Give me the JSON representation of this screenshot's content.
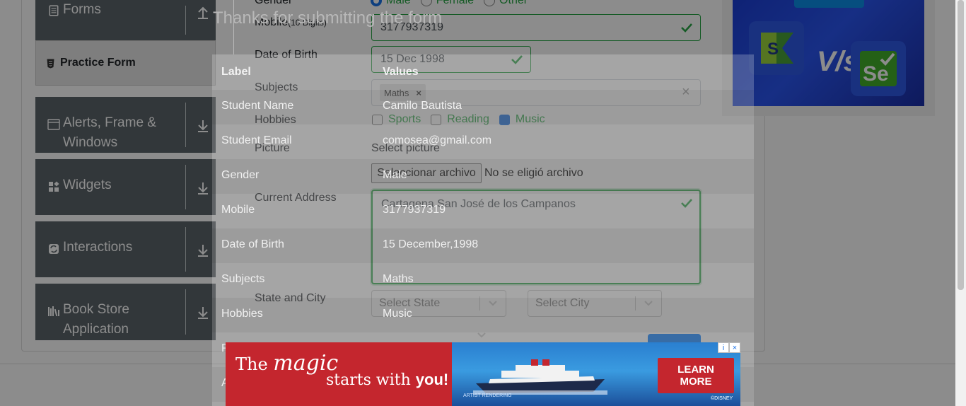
{
  "sidebar": {
    "forms_label": "Forms",
    "practice_form_label": "Practice Form",
    "alerts_label_1": "Alerts, Frame &",
    "alerts_label_2": "Windows",
    "widgets_label": "Widgets",
    "interactions_label": "Interactions",
    "bookstore_label_1": "Book Store",
    "bookstore_label_2": "Application"
  },
  "form": {
    "gender_label": "Gender",
    "gender_options": [
      "Male",
      "Female",
      "Other"
    ],
    "mobile_label": "Mobile",
    "mobile_hint": "(10 Digits)",
    "mobile_value": "3177937319",
    "dob_label": "Date of Birth",
    "dob_value": "15 Dec 1998",
    "subjects_label": "Subjects",
    "subject_chip": "Maths",
    "chip_remove": "×",
    "clear_icon": "×",
    "hobbies_label": "Hobbies",
    "hobbies": [
      "Sports",
      "Reading",
      "Music"
    ],
    "picture_label": "Picture",
    "picture_hint": "Select picture",
    "file_button": "Seleccionar archivo",
    "file_status": "No se eligió archivo",
    "address_label": "Current Address",
    "address_value": "Cartagena San José de los Campanos",
    "state_city_label": "State and City",
    "state_placeholder": "Select State",
    "city_placeholder": "Select City"
  },
  "modal": {
    "title": "Thanks for submitting the form",
    "col_label": "Label",
    "col_values": "Values",
    "rows": [
      {
        "label": "Student Name",
        "value": "Camilo Bautista"
      },
      {
        "label": "Student Email",
        "value": "comosea@gmail.com"
      },
      {
        "label": "Gender",
        "value": "Male"
      },
      {
        "label": "Mobile",
        "value": "3177937319"
      },
      {
        "label": "Date of Birth",
        "value": "15 December,1998"
      },
      {
        "label": "Subjects",
        "value": "Maths"
      },
      {
        "label": "Hobbies",
        "value": "Music"
      },
      {
        "label": "P",
        "value": ""
      },
      {
        "label": "A",
        "value": ""
      }
    ]
  },
  "ad": {
    "line1_a": "The ",
    "line1_b": "magic",
    "line2_a": "starts with ",
    "line2_b": "you!",
    "cta_1": "LEARN",
    "cta_2": "MORE",
    "fine_print": "ARTIST RENDERING",
    "brand": "©DISNEY",
    "info_icon": "i",
    "close_icon": "×"
  },
  "promo": {
    "vs_text": "V/s"
  },
  "colors": {
    "sidebar_bg": "#5b646a",
    "valid_green": "#28a745",
    "ad_red": "#c4262e",
    "promo_blue": "#2a55f0"
  }
}
